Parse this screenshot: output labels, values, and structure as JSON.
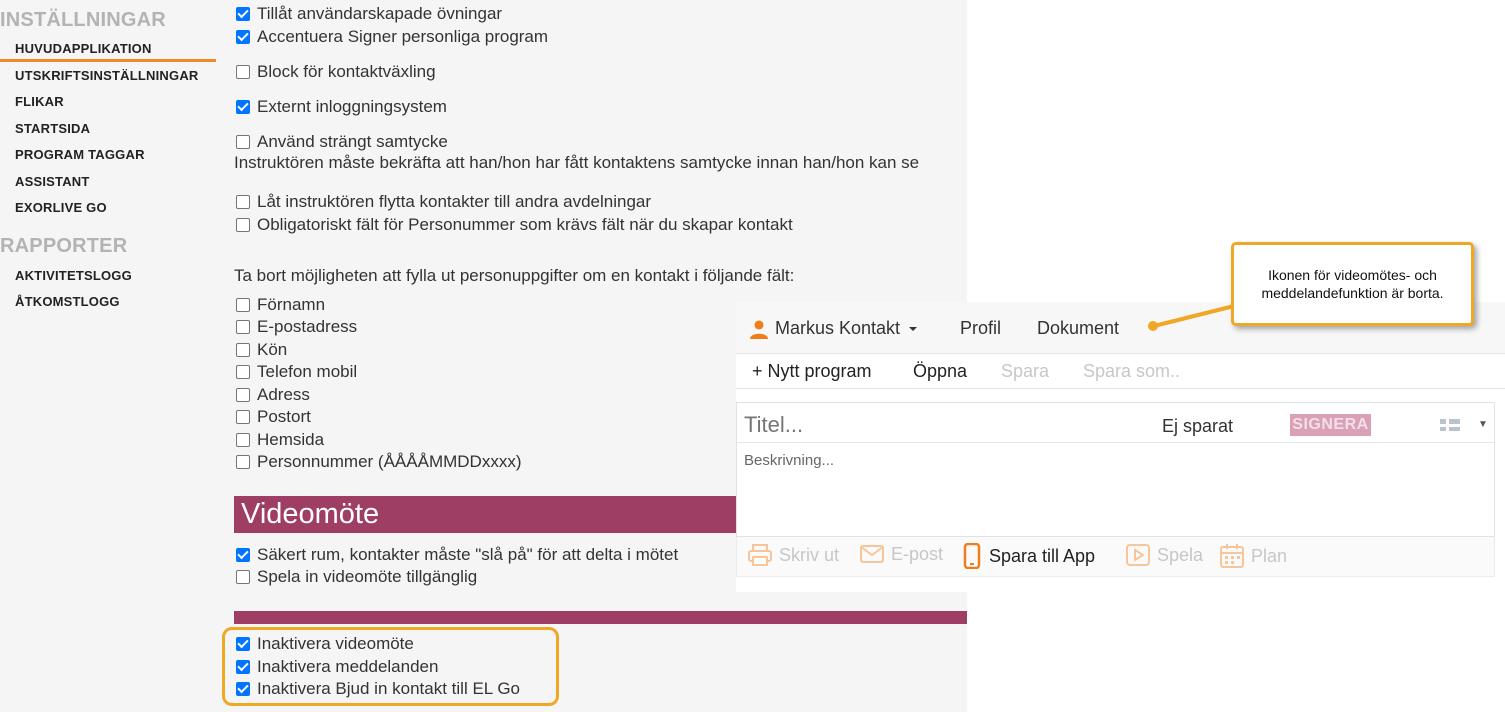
{
  "sidebar": {
    "settings_heading": "INSTÄLLNINGAR",
    "settings_items": [
      "HUVUDAPPLIKATION",
      "UTSKRIFTSINSTÄLLNINGAR",
      "FLIKAR",
      "STARTSIDA",
      "PROGRAM TAGGAR",
      "ASSISTANT",
      "EXORLIVE GO"
    ],
    "reports_heading": "RAPPORTER",
    "reports_items": [
      "AKTIVITETSLOGG",
      "ÅTKOMSTLOGG"
    ],
    "active_item": "HUVUDAPPLIKATION",
    "accent_color": "#ee8a2a"
  },
  "settings": {
    "options": [
      {
        "label": "Tillåt användarskapade övningar",
        "checked": true
      },
      {
        "label": "Accentuera Signer personliga program",
        "checked": true
      },
      {
        "label": "Block för kontaktväxling",
        "checked": false
      },
      {
        "label": "Externt inloggningsystem",
        "checked": true
      },
      {
        "label": "Använd strängt samtycke",
        "checked": false
      },
      {
        "label": "Låt instruktören flytta kontakter till andra avdelningar",
        "checked": false
      },
      {
        "label": "Obligatoriskt fält för Personummer som krävs fält när du skapar kontakt",
        "checked": false
      }
    ],
    "consent_note": "Instruktören måste bekräfta att han/hon har fått kontaktens samtycke innan han/hon kan se",
    "remove_fields_label": "Ta bort möjligheten att fylla ut personuppgifter om en kontakt i följande fält:",
    "fields": [
      {
        "label": "Förnamn",
        "checked": false
      },
      {
        "label": "E-postadress",
        "checked": false
      },
      {
        "label": "Kön",
        "checked": false
      },
      {
        "label": "Telefon mobil",
        "checked": false
      },
      {
        "label": "Adress",
        "checked": false
      },
      {
        "label": "Postort",
        "checked": false
      },
      {
        "label": "Hemsida",
        "checked": false
      },
      {
        "label": "Personnummer (ÅÅÅÅMMDDxxxx)",
        "checked": false
      }
    ],
    "video_section_title": "Videomöte",
    "video_options": [
      {
        "label": "Säkert rum, kontakter måste \"slå på\" för att delta i mötet",
        "checked": true
      },
      {
        "label": "Spela in videomöte tillgänglig",
        "checked": false
      }
    ],
    "disable_options": [
      {
        "label": "Inaktivera videomöte",
        "checked": true
      },
      {
        "label": "Inaktivera meddelanden",
        "checked": true
      },
      {
        "label": "Inaktivera Bjud in kontakt till EL Go",
        "checked": true
      }
    ],
    "section_color": "#9e3e64"
  },
  "app": {
    "user_name": "Markus Kontakt",
    "nav": {
      "profile": "Profil",
      "documents": "Dokument"
    },
    "toolbar": {
      "new_program": "+ Nytt program",
      "open": "Öppna",
      "save": "Spara",
      "save_as": "Spara som.."
    },
    "title_placeholder": "Titel...",
    "status": "Ej sparat",
    "sign_button": "SIGNERA",
    "description_placeholder": "Beskrivning...",
    "actions": {
      "print": "Skriv ut",
      "email": "E-post",
      "save_to_app": "Spara till App",
      "play": "Spela",
      "plan": "Plan"
    },
    "accent_color": "#ef7d1a"
  },
  "callout": {
    "text": "Ikonen för videomötes- och meddelandefunktion är borta.",
    "border_color": "#efa826"
  }
}
